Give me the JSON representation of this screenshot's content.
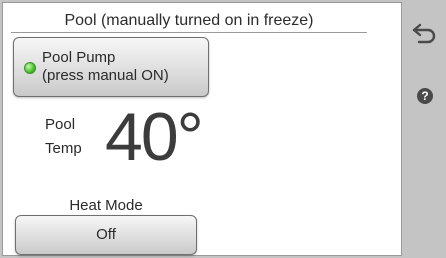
{
  "header": {
    "title": "Pool (manually turned on in freeze)"
  },
  "pump": {
    "label_line1": "Pool Pump",
    "label_line2": "(press manual ON)",
    "status_color": "#45c22a"
  },
  "temperature": {
    "label_line1": "Pool",
    "label_line2": "Temp",
    "value": "40°"
  },
  "heat_mode": {
    "label": "Heat Mode",
    "value": "Off"
  },
  "sidebar": {
    "back_icon": "back-arrow-icon",
    "help_icon": "help-icon",
    "help_glyph": "?"
  }
}
